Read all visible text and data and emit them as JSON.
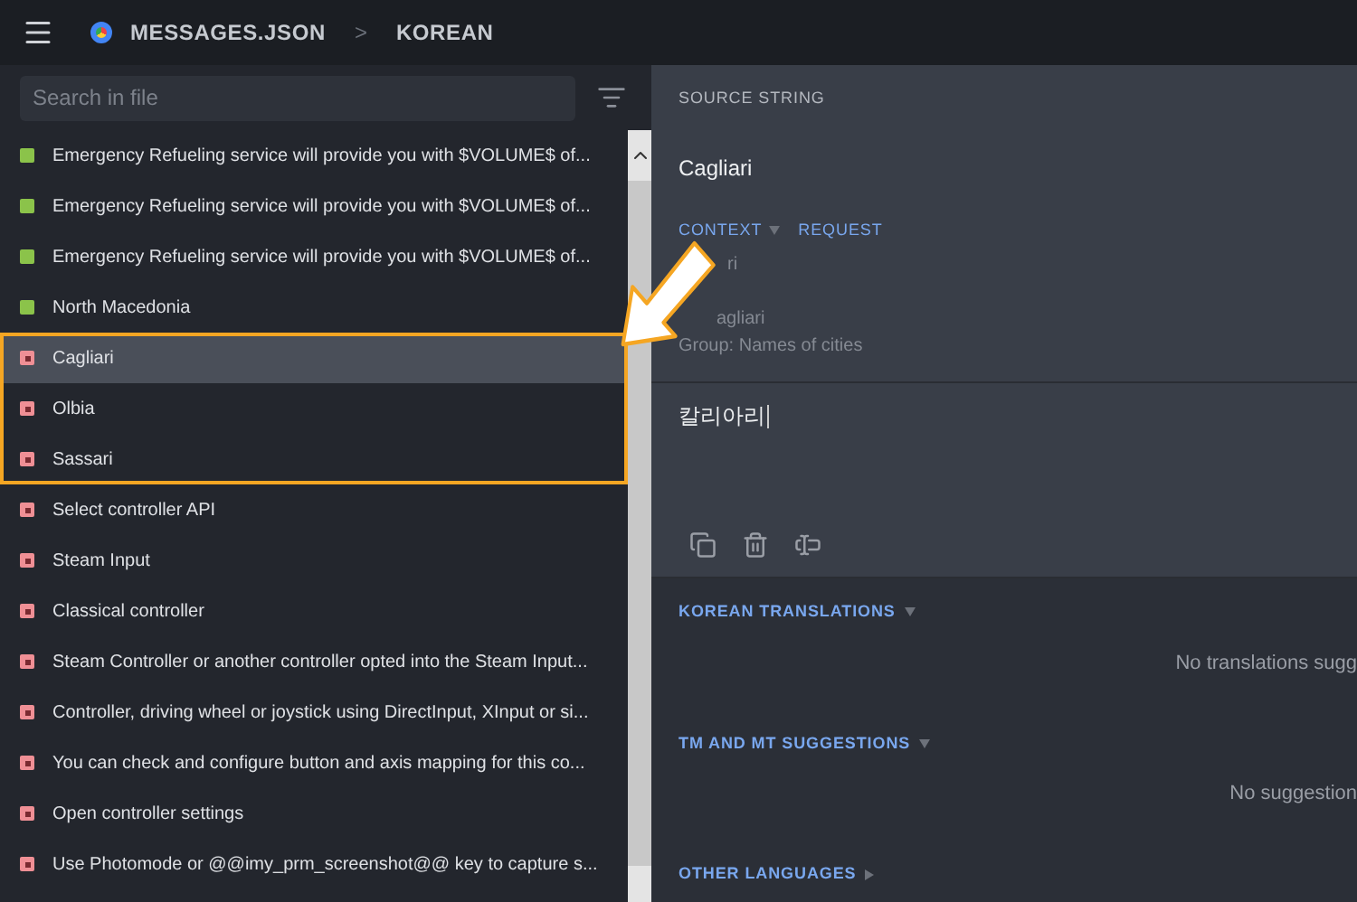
{
  "header": {
    "file": "MESSAGES.JSON",
    "separator": ">",
    "language": "KOREAN"
  },
  "search": {
    "placeholder": "Search in file"
  },
  "strings": [
    {
      "kind": "translated",
      "text": "Emergency Refueling service will provide you with $VOLUME$ of...",
      "selected": false,
      "highlighted": false
    },
    {
      "kind": "translated",
      "text": "Emergency Refueling service will provide you with $VOLUME$ of...",
      "selected": false,
      "highlighted": false
    },
    {
      "kind": "translated",
      "text": "Emergency Refueling service will provide you with $VOLUME$ of...",
      "selected": false,
      "highlighted": false
    },
    {
      "kind": "translated",
      "text": "North Macedonia",
      "selected": false,
      "highlighted": false
    },
    {
      "kind": "untranslated",
      "text": "Cagliari",
      "selected": true,
      "highlighted": true
    },
    {
      "kind": "untranslated",
      "text": "Olbia",
      "selected": false,
      "highlighted": true
    },
    {
      "kind": "untranslated",
      "text": "Sassari",
      "selected": false,
      "highlighted": true
    },
    {
      "kind": "untranslated",
      "text": "Select controller API",
      "selected": false,
      "highlighted": false
    },
    {
      "kind": "untranslated",
      "text": "Steam Input",
      "selected": false,
      "highlighted": false
    },
    {
      "kind": "untranslated",
      "text": "Classical controller",
      "selected": false,
      "highlighted": false
    },
    {
      "kind": "untranslated",
      "text": "Steam Controller or another controller opted into the Steam Input...",
      "selected": false,
      "highlighted": false
    },
    {
      "kind": "untranslated",
      "text": "Controller, driving wheel or joystick using DirectInput, XInput or si...",
      "selected": false,
      "highlighted": false
    },
    {
      "kind": "untranslated",
      "text": "You can check and configure button and axis mapping for this co...",
      "selected": false,
      "highlighted": false
    },
    {
      "kind": "untranslated",
      "text": "Open controller settings",
      "selected": false,
      "highlighted": false
    },
    {
      "kind": "untranslated",
      "text": "Use Photomode or @@imy_prm_screenshot@@ key to capture s...",
      "selected": false,
      "highlighted": false
    }
  ],
  "source": {
    "heading": "SOURCE STRING",
    "text": "Cagliari",
    "context_tab": "CONTEXT",
    "request_tab": "REQUEST",
    "context_lines": [
      "ri",
      "agliari",
      "Group: Names of cities"
    ]
  },
  "translation": {
    "value": "칼리아리"
  },
  "sections": [
    {
      "title": "KOREAN TRANSLATIONS",
      "expanded": true,
      "empty_text": "No translations sugg"
    },
    {
      "title": "TM AND MT SUGGESTIONS",
      "expanded": true,
      "empty_text": "No suggestion"
    },
    {
      "title": "OTHER LANGUAGES",
      "expanded": false
    }
  ]
}
